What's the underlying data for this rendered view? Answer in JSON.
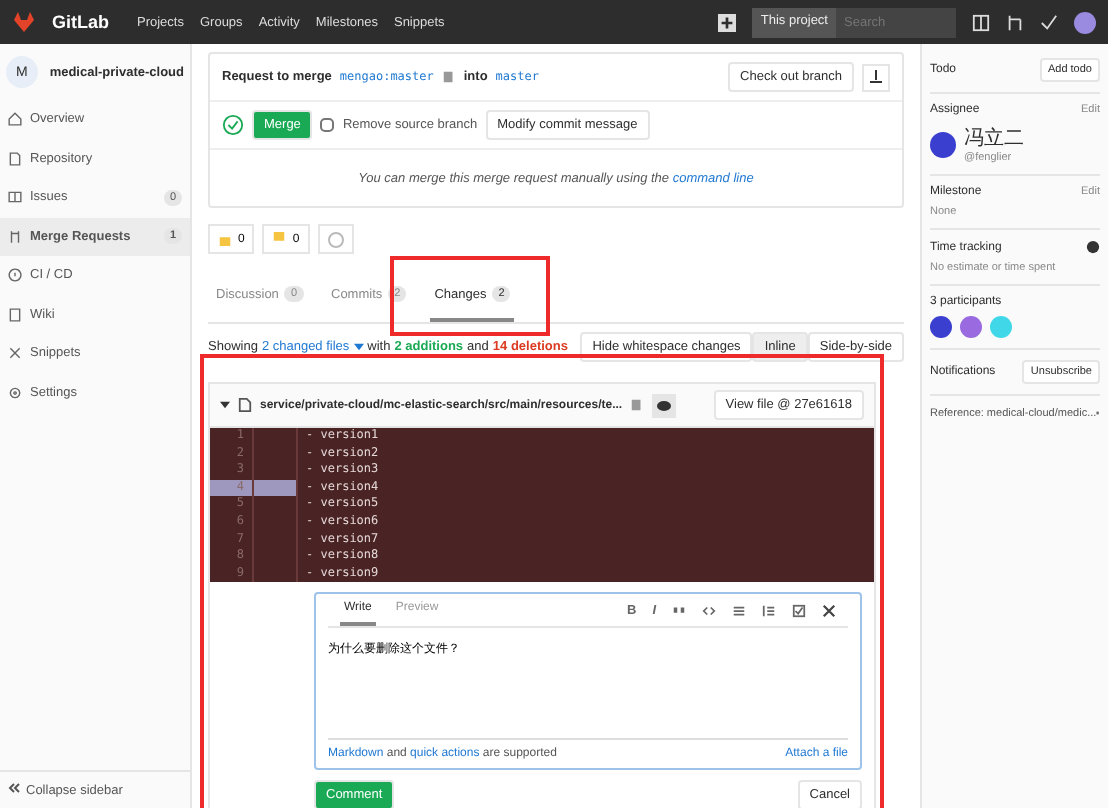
{
  "topbar": {
    "logo": "GitLab",
    "nav": [
      "Projects",
      "Groups",
      "Activity",
      "Milestones",
      "Snippets"
    ],
    "scope": "This project",
    "search_placeholder": "Search"
  },
  "sidebar": {
    "project_initial": "M",
    "project": "medical-private-cloud",
    "items": [
      {
        "label": "Overview",
        "selected": false
      },
      {
        "label": "Repository",
        "selected": false
      },
      {
        "label": "Issues",
        "count": "0",
        "selected": false
      },
      {
        "label": "Merge Requests",
        "count": "1",
        "selected": true
      },
      {
        "label": "CI / CD",
        "selected": false
      },
      {
        "label": "Wiki",
        "selected": false
      },
      {
        "label": "Snippets",
        "selected": false
      },
      {
        "label": "Settings",
        "selected": false
      }
    ],
    "collapse": "Collapse sidebar"
  },
  "merge": {
    "request_to": "Request to merge",
    "source": "mengao:master",
    "into": "into",
    "target": "master",
    "checkout": "Check out branch",
    "merge_button": "Merge",
    "remove_source": {
      "label": "Remove source branch",
      "checked": false
    },
    "modify": "Modify commit message",
    "manual_prefix": "You can merge this merge request manually using the",
    "manual_link": "command line"
  },
  "awards": [
    {
      "kind": "up",
      "count": "0"
    },
    {
      "kind": "down",
      "count": "0"
    },
    {
      "kind": "smile"
    }
  ],
  "tabs": [
    {
      "label": "Discussion",
      "count": "0",
      "selected": false
    },
    {
      "label": "Commits",
      "count": "2",
      "selected": false
    },
    {
      "label": "Changes",
      "count": "2",
      "selected": true
    }
  ],
  "summary": {
    "prefix": "Showing",
    "files": "2 changed files",
    "with": "with",
    "additions": "2 additions",
    "and": "and",
    "deletions": "14 deletions"
  },
  "view_controls": [
    {
      "label": "Hide whitespace changes",
      "selected": false
    },
    {
      "label": "Inline",
      "selected": true
    },
    {
      "label": "Side-by-side",
      "selected": false
    }
  ],
  "diff": {
    "path": "service/private-cloud/mc-elastic-search/src/main/resources/te...",
    "view_file": "View file @ 27e61618",
    "lines": [
      {
        "old": "1",
        "sign": "-",
        "text": "version1",
        "selected": false
      },
      {
        "old": "2",
        "sign": "-",
        "text": "version2",
        "selected": false
      },
      {
        "old": "3",
        "sign": "-",
        "text": "version3",
        "selected": false
      },
      {
        "old": "4",
        "sign": "-",
        "text": "version4",
        "selected": true
      },
      {
        "old": "5",
        "sign": "-",
        "text": "version5",
        "selected": false
      },
      {
        "old": "6",
        "sign": "-",
        "text": "version6",
        "selected": false
      },
      {
        "old": "7",
        "sign": "-",
        "text": "version7",
        "selected": false
      },
      {
        "old": "8",
        "sign": "-",
        "text": "version8",
        "selected": false
      },
      {
        "old": "9",
        "sign": "-",
        "text": "version9",
        "selected": false
      }
    ]
  },
  "comment": {
    "tabs": [
      {
        "label": "Write",
        "selected": true
      },
      {
        "label": "Preview",
        "selected": false
      }
    ],
    "toolbar": [
      "B",
      "I"
    ],
    "value": "为什么要删除这个文件？",
    "markdown": "Markdown",
    "and": "and",
    "quick_actions": "quick actions",
    "supported": "are supported",
    "attach": "Attach a file",
    "submit": "Comment",
    "cancel": "Cancel"
  },
  "right": {
    "todo": "Todo",
    "add_todo": "Add todo",
    "assignee_label": "Assignee",
    "edit": "Edit",
    "assignee_name": "冯立二",
    "assignee_handle": "@fenglier",
    "milestone_label": "Milestone",
    "milestone_edit": "Edit",
    "milestone": "None",
    "time_label": "Time tracking",
    "time": "No estimate or time spent",
    "participants": "3 participants",
    "participant_list": [
      {
        "color": "#3b3fd0"
      },
      {
        "color": "#9a6ae0"
      },
      {
        "color": "#40d8e8"
      }
    ],
    "notifications": "Notifications",
    "unsubscribe": "Unsubscribe",
    "reference": "Reference: medical-cloud/medic..."
  }
}
